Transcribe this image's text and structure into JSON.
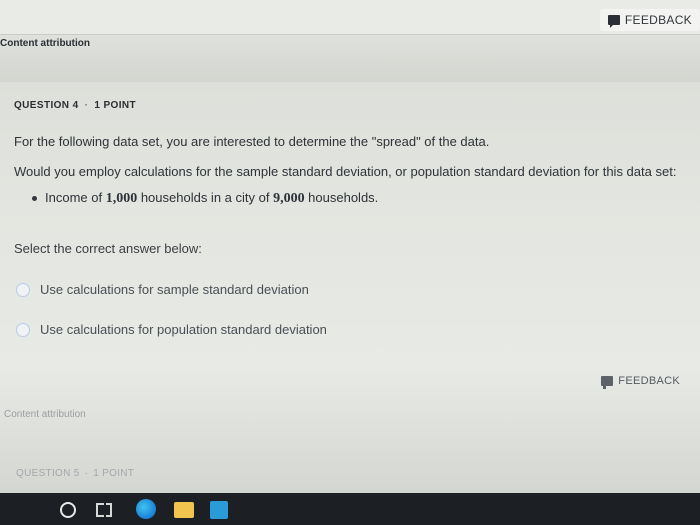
{
  "feedback": {
    "label": "FEEDBACK"
  },
  "content_attribution": "Content attribution",
  "question4": {
    "number_label": "QUESTION 4",
    "points_label": "1 POINT",
    "line1": "For the following data set, you are interested to determine the \"spread\" of the data.",
    "line2": "Would you employ calculations for the sample standard deviation, or population standard deviation for this data set:",
    "bullet_pre": "Income of ",
    "bullet_num1": "1,000",
    "bullet_mid": " households in a city of ",
    "bullet_num2": "9,000",
    "bullet_post": " households.",
    "select_label": "Select the correct answer below:",
    "options": [
      {
        "label": "Use calculations for sample standard deviation"
      },
      {
        "label": "Use calculations for population standard deviation"
      }
    ]
  },
  "question5": {
    "number_label": "QUESTION 5",
    "points_label": "1 POINT"
  },
  "separator": "·",
  "taskbar": {
    "icons": [
      "search-icon",
      "task-view-icon",
      "edge-browser-icon",
      "file-explorer-icon",
      "store-icon"
    ]
  }
}
